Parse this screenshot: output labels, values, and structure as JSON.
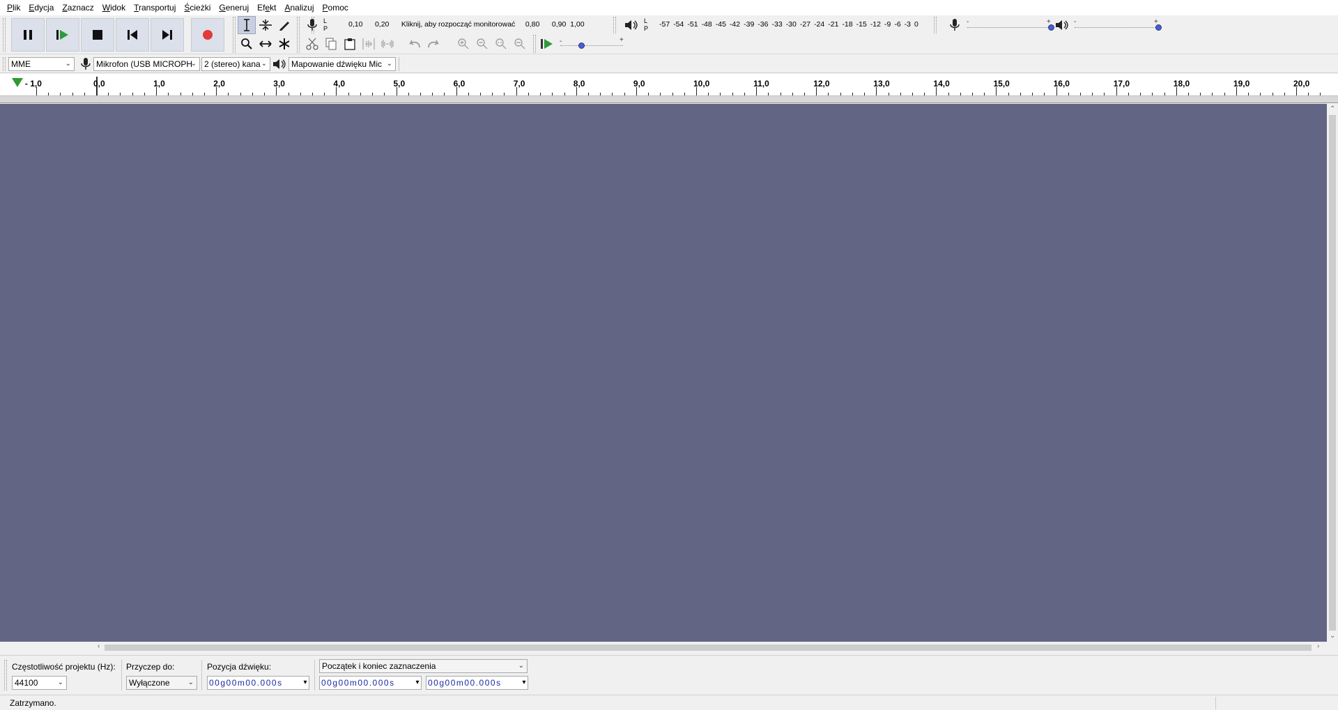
{
  "menu": [
    {
      "pre": "",
      "ul": "P",
      "post": "lik"
    },
    {
      "pre": "",
      "ul": "E",
      "post": "dycja"
    },
    {
      "pre": "",
      "ul": "Z",
      "post": "aznacz"
    },
    {
      "pre": "",
      "ul": "W",
      "post": "idok"
    },
    {
      "pre": "",
      "ul": "T",
      "post": "ransportuj"
    },
    {
      "pre": "",
      "ul": "Ś",
      "post": "cieżki"
    },
    {
      "pre": "",
      "ul": "G",
      "post": "eneruj"
    },
    {
      "pre": "Ef",
      "ul": "e",
      "post": "kt"
    },
    {
      "pre": "",
      "ul": "A",
      "post": "nalizuj"
    },
    {
      "pre": "",
      "ul": "P",
      "post": "omoc"
    }
  ],
  "transport": {
    "buttons": [
      "pause",
      "play",
      "stop",
      "skip-start",
      "skip-end",
      "record"
    ],
    "accent_record": "#e03a3a",
    "accent_play": "#2e9a3e"
  },
  "meters": {
    "record_L": "L",
    "record_P": "P",
    "record_left_ticks": [
      "0,10",
      "0,20"
    ],
    "record_prompt": "Kliknij, aby rozpocząć monitorować",
    "record_right_ticks": [
      "0,80",
      "0,90",
      "1,00"
    ],
    "play_L": "L",
    "play_P": "P",
    "play_ticks": [
      "-57",
      "-54",
      "-51",
      "-48",
      "-45",
      "-42",
      "-39",
      "-36",
      "-33",
      "-30",
      "-27",
      "-24",
      "-21",
      "-18",
      "-15",
      "-12",
      "-9",
      "-6",
      "-3",
      "0"
    ],
    "minus": "-",
    "plus": "+"
  },
  "mixer": {
    "record_volume_level": 1.0,
    "playback_volume_level": 1.0
  },
  "play_at_speed": {
    "speed_level": 0.33
  },
  "devices": {
    "host": "MME",
    "recording_device": "Mikrofon (USB MICROPH",
    "channels": "2 (stereo) kana",
    "playback_device": "Mapowanie dźwięku Mic"
  },
  "ruler": {
    "labels": [
      "- 1,0",
      "0,0",
      "1,0",
      "2,0",
      "3,0",
      "4,0",
      "5,0",
      "6,0",
      "7,0",
      "8,0",
      "9,0",
      "10,0",
      "11,0",
      "12,0",
      "13,0",
      "14,0",
      "15,0",
      "16,0",
      "17,0",
      "18,0",
      "19,0",
      "20,0"
    ]
  },
  "colors": {
    "track_background": "#626583",
    "ruler_background": "#ffffff",
    "time_digits": "#1a2aa0"
  },
  "selection_toolbar": {
    "project_rate_label": "Częstotliwość projektu (Hz):",
    "project_rate_value": "44100",
    "snap_label": "Przyczep do:",
    "snap_value": "Wyłączone",
    "audio_position_label": "Pozycja dźwięku:",
    "audio_position_value": "00g00m00.000s",
    "selection_mode": "Początek i koniec zaznaczenia",
    "selection_start": "00g00m00.000s",
    "selection_end": "00g00m00.000s"
  },
  "status": {
    "text": "Zatrzymano."
  }
}
